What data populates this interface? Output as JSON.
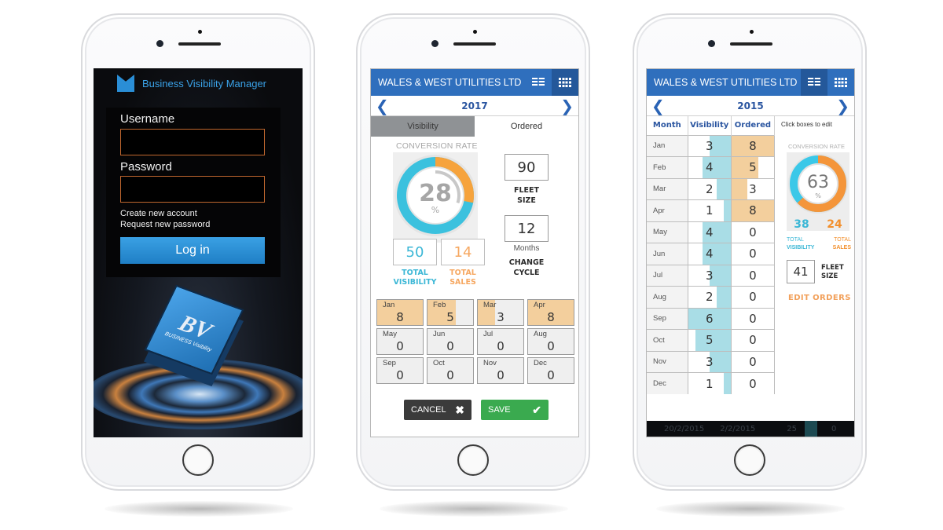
{
  "login_screen": {
    "app_title": "Business Visibility Manager",
    "logo_icon": "bv-logo-icon",
    "username_label": "Username",
    "username_value": "",
    "password_label": "Password",
    "password_value": "",
    "create_account_link": "Create new account",
    "request_password_link": "Request new password",
    "login_button": "Log in",
    "cube_mark": "BV",
    "cube_text": "BUSINESS Visibility"
  },
  "monthly_screen": {
    "company": "WALES & WEST UTILITIES LTD",
    "list_view_icon": "list-view-icon",
    "grid_view_icon": "grid-view-icon",
    "prev_icon": "chevron-left-icon",
    "next_icon": "chevron-right-icon",
    "year": "2017",
    "tabs": [
      {
        "label": "Visibility",
        "active": true
      },
      {
        "label": "Ordered",
        "active": false
      }
    ],
    "conversion_rate_label": "CONVERSION RATE",
    "conversion_rate": 28,
    "percent_sign": "%",
    "total_visibility": "50",
    "total_visibility_label_1": "TOTAL",
    "total_visibility_label_2": "VISIBILITY",
    "total_sales": "14",
    "total_sales_label_1": "TOTAL",
    "total_sales_label_2": "SALES",
    "fleet_size": "90",
    "fleet_size_label_1": "FLEET",
    "fleet_size_label_2": "SIZE",
    "change_cycle": "12",
    "change_cycle_unit": "Months",
    "change_cycle_label_1": "CHANGE",
    "change_cycle_label_2": "CYCLE",
    "months": [
      {
        "name": "Jan",
        "value": "8",
        "fill": 1.0
      },
      {
        "name": "Feb",
        "value": "5",
        "fill": 0.62
      },
      {
        "name": "Mar",
        "value": "3",
        "fill": 0.38
      },
      {
        "name": "Apr",
        "value": "8",
        "fill": 1.0
      },
      {
        "name": "May",
        "value": "0",
        "fill": 0
      },
      {
        "name": "Jun",
        "value": "0",
        "fill": 0
      },
      {
        "name": "Jul",
        "value": "0",
        "fill": 0
      },
      {
        "name": "Aug",
        "value": "0",
        "fill": 0
      },
      {
        "name": "Sep",
        "value": "0",
        "fill": 0
      },
      {
        "name": "Oct",
        "value": "0",
        "fill": 0
      },
      {
        "name": "Nov",
        "value": "0",
        "fill": 0
      },
      {
        "name": "Dec",
        "value": "0",
        "fill": 0
      }
    ],
    "cancel_button": "CANCEL",
    "cancel_icon": "✖",
    "save_button": "SAVE",
    "save_icon": "✔"
  },
  "table_screen": {
    "company": "WALES & WEST UTILITIES LTD",
    "year": "2015",
    "columns": [
      "Month",
      "Visibility",
      "Ordered"
    ],
    "hint": "Click boxes to edit",
    "rows": [
      {
        "month": "Jan",
        "visibility": 3,
        "ordered": 8
      },
      {
        "month": "Feb",
        "visibility": 4,
        "ordered": 5
      },
      {
        "month": "Mar",
        "visibility": 2,
        "ordered": 3
      },
      {
        "month": "Apr",
        "visibility": 1,
        "ordered": 8
      },
      {
        "month": "May",
        "visibility": 4,
        "ordered": 0
      },
      {
        "month": "Jun",
        "visibility": 4,
        "ordered": 0
      },
      {
        "month": "Jul",
        "visibility": 3,
        "ordered": 0
      },
      {
        "month": "Aug",
        "visibility": 2,
        "ordered": 0
      },
      {
        "month": "Sep",
        "visibility": 6,
        "ordered": 0
      },
      {
        "month": "Oct",
        "visibility": 5,
        "ordered": 0
      },
      {
        "month": "Nov",
        "visibility": 3,
        "ordered": 0
      },
      {
        "month": "Dec",
        "visibility": 1,
        "ordered": 0
      }
    ],
    "conversion_rate_label": "CONVERSION RATE",
    "conversion_rate": 63,
    "percent_sign": "%",
    "total_visibility": "38",
    "total_sales": "24",
    "total_label": "TOTAL",
    "visibility_label": "VISIBILITY",
    "sales_label": "SALES",
    "fleet_size": "41",
    "fleet_label_1": "FLEET",
    "fleet_label_2": "SIZE",
    "edit_orders": "EDIT ORDERS",
    "footer": {
      "date1": "20/2/2015",
      "date2": "2/2/2015",
      "v1": "25",
      "v2": "0"
    }
  },
  "colors": {
    "brand_blue": "#2f6fbd",
    "visibility_teal": "#3bb7d6",
    "sales_orange": "#f28f2c",
    "ordered_fill": "#f3cf9d",
    "visibility_fill": "#a9dde6",
    "save_green": "#3aaa4f"
  }
}
